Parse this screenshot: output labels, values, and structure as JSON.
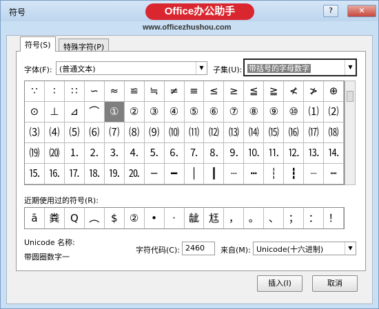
{
  "window": {
    "title": "符号",
    "help_label": "?",
    "close_label": "✕"
  },
  "watermark": {
    "brand": "Office办公助手",
    "url": "www.officezhushou.com"
  },
  "tabs": [
    {
      "label": "符号(S)"
    },
    {
      "label": "特殊字符(P)"
    }
  ],
  "font": {
    "label": "字体(F):",
    "value": "(普通文本)"
  },
  "subset": {
    "label": "子集(U):",
    "value": "带括号的字母数字"
  },
  "symbols": [
    "∵",
    "∶",
    "∷",
    "∽",
    "≈",
    "≌",
    "≒",
    "≠",
    "≡",
    "≤",
    "≥",
    "≦",
    "≧",
    "≮",
    "≯",
    "⊕",
    "⊙",
    "⊥",
    "⊿",
    "⌒",
    "①",
    "②",
    "③",
    "④",
    "⑤",
    "⑥",
    "⑦",
    "⑧",
    "⑨",
    "⑩",
    "⑴",
    "⑵",
    "⑶",
    "⑷",
    "⑸",
    "⑹",
    "⑺",
    "⑻",
    "⑼",
    "⑽",
    "⑾",
    "⑿",
    "⒀",
    "⒁",
    "⒂",
    "⒃",
    "⒄",
    "⒅",
    "⒆",
    "⒇",
    "⒈",
    "⒉",
    "⒊",
    "⒋",
    "⒌",
    "⒍",
    "⒎",
    "⒏",
    "⒐",
    "⒑",
    "⒒",
    "⒓",
    "⒔",
    "⒕",
    "⒖",
    "⒗",
    "⒘",
    "⒙",
    "⒚",
    "⒛",
    "─",
    "━",
    "│",
    "┃",
    "┄",
    "┅",
    "┆",
    "┇",
    "┈",
    "┉"
  ],
  "selected_index": 20,
  "recent": {
    "label": "近期使用过的符号(R):",
    "symbols": [
      "ā",
      "粪",
      "Q",
      "︵",
      "$",
      "②",
      "•",
      "·",
      "龇",
      "尪",
      "，",
      "。",
      "、",
      "；",
      "：",
      "！"
    ]
  },
  "unicode_name": {
    "label": "Unicode 名称:",
    "value": "带圆圈数字一"
  },
  "char_code": {
    "label": "字符代码(C):",
    "value": "2460"
  },
  "from": {
    "label": "来自(M):",
    "value": "Unicode(十六进制)"
  },
  "buttons": {
    "insert": "插入(I)",
    "cancel": "取消"
  }
}
